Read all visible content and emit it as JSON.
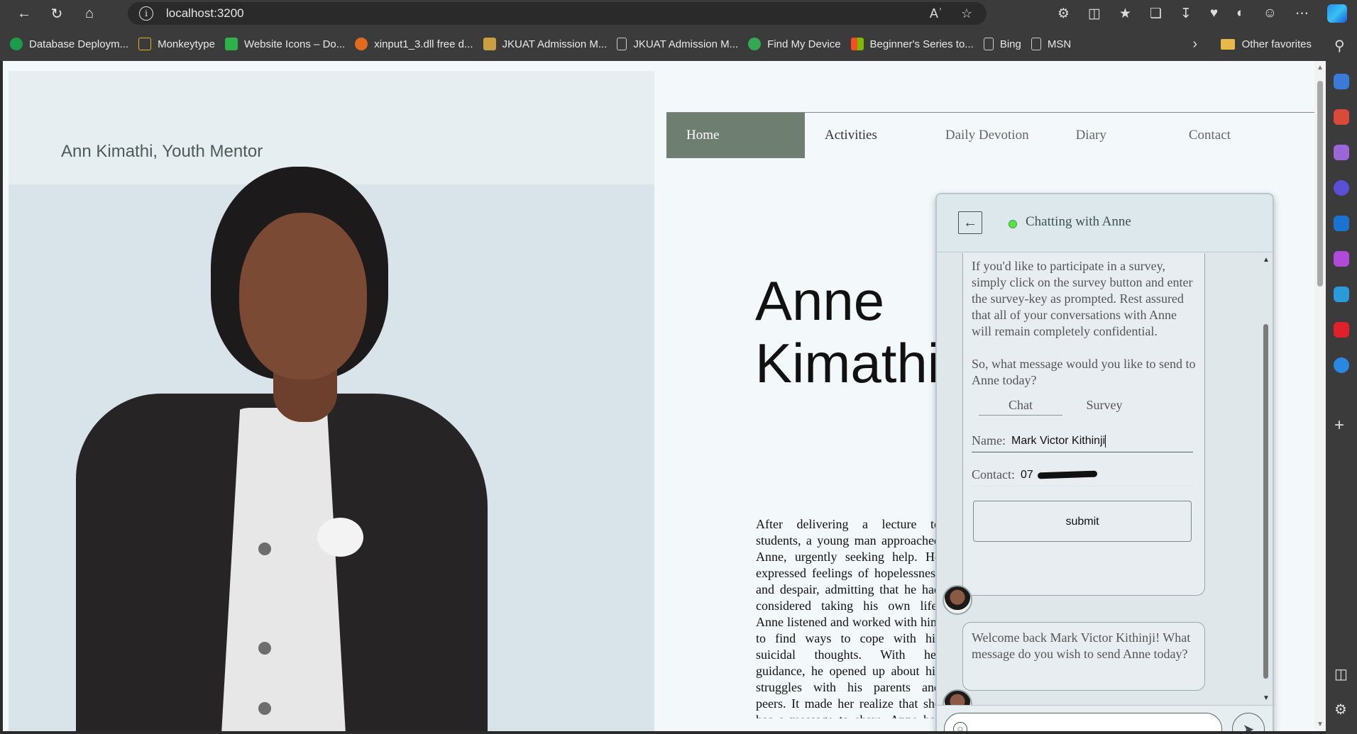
{
  "browser": {
    "url": "localhost:3200",
    "read_aloud": "Aʾ",
    "bookmarks": [
      {
        "label": "Database Deploym...",
        "color": "#1a9c4a"
      },
      {
        "label": "Monkeytype",
        "color": "#e2b714"
      },
      {
        "label": "Website Icons – Do...",
        "color": "#2db34a"
      },
      {
        "label": "xinput1_3.dll free d...",
        "color": "#e06b1f"
      },
      {
        "label": "JKUAT Admission M...",
        "color": "#c8a040"
      },
      {
        "label": "JKUAT Admission M...",
        "color": "#cccccc"
      },
      {
        "label": "Find My Device",
        "color": "#34a853"
      },
      {
        "label": "Beginner's Series to...",
        "color": "#f25022"
      },
      {
        "label": "Bing",
        "color": "#cccccc"
      },
      {
        "label": "MSN",
        "color": "#cccccc"
      }
    ],
    "other_favorites": "Other favorites"
  },
  "site": {
    "mentor_title": "Ann Kimathi, Youth Mentor",
    "nav": [
      "Home",
      "Activities",
      "Daily Devotion",
      "Diary",
      "Contact"
    ],
    "hero_name": "Anne\nKimathi",
    "bio": "After delivering a lecture to students, a young man approached Anne, urgently seeking help. He expressed feelings of hopelessness and despair, admitting that he had considered taking his own life. Anne listened and worked with him to find ways to cope with his suicidal thoughts. With her guidance, he opened up about his struggles with his parents and peers. It made her realize that she has a message to share. Anne has gained very unique perspectives on the challenges of the youth after years and years of mentoring, through thought provoking presentations, she inspires them to stand up and make a difference"
  },
  "chat": {
    "title": "Chatting with Anne",
    "status_color": "#5ee04a",
    "intro_1": "If you'd like to participate in a survey, simply click on the survey button and enter the survey-key as prompted. Rest assured that all of your conversations with Anne will remain completely confidential.",
    "intro_2": "So, what message would you like to send to Anne today?",
    "tab_chat": "Chat",
    "tab_survey": "Survey",
    "name_label": "Name:",
    "name_value": "Mark Victor Kithinji",
    "contact_label": "Contact:",
    "contact_value": "07",
    "submit_label": "submit",
    "welcome": "Welcome back Mark Victor Kithinji! What message do you wish to send Anne today?",
    "message_value": ""
  },
  "colors": {
    "nav_active": "#6e7f72",
    "chat_bg": "#e4edf1"
  }
}
